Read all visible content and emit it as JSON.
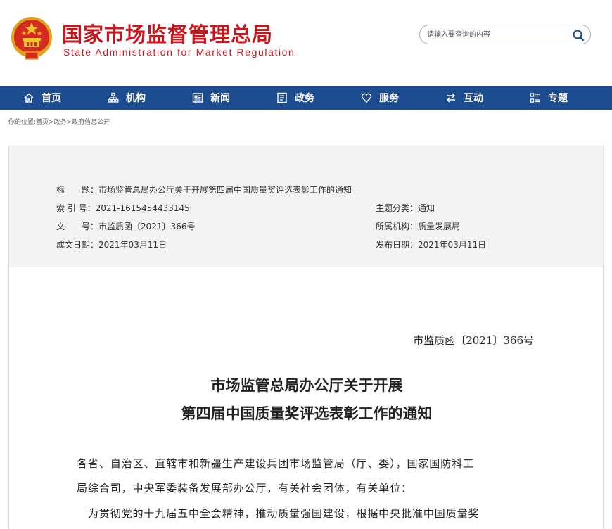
{
  "header": {
    "site_title": "国家市场监督管理总局",
    "site_subtitle": "State Administration for Market Regulation",
    "search_placeholder": "请输入要查询的内容"
  },
  "colors": {
    "brand_red": "#c8161d",
    "nav_blue": "#1c4c8f"
  },
  "nav": [
    {
      "label": "首页",
      "icon": "home-icon"
    },
    {
      "label": "机构",
      "icon": "org-chart-icon"
    },
    {
      "label": "新闻",
      "icon": "news-icon"
    },
    {
      "label": "政务",
      "icon": "government-affairs-icon"
    },
    {
      "label": "服务",
      "icon": "heart-icon"
    },
    {
      "label": "互动",
      "icon": "exchange-arrows-icon"
    },
    {
      "label": "专题",
      "icon": "topics-icon"
    }
  ],
  "breadcrumb": {
    "prefix": "你的位置:",
    "items": [
      "首页",
      "政务",
      "政府信息公开"
    ],
    "separator": ">"
  },
  "info": {
    "title_key": "标　　题：",
    "title_val": "市场监管总局办公厅关于开展第四届中国质量奖评选表彰工作的通知",
    "index_key": "索 引 号：",
    "index_val": "2021-1615454433145",
    "category_key": "主题分类：",
    "category_val": "通知",
    "docno_key": "文　　号：",
    "docno_val": "市监质函〔2021〕366号",
    "org_key": "所属机构：",
    "org_val": "质量发展局",
    "created_key": "成文日期：",
    "created_val": "2021年03月11日",
    "published_key": "发布日期：",
    "published_val": "2021年03月11日"
  },
  "document": {
    "doc_number": "市监质函〔2021〕366号",
    "title_line1": "市场监管总局办公厅关于开展",
    "title_line2": "第四届中国质量奖评选表彰工作的通知",
    "para1_line1": "各省、自治区、直辖市和新疆生产建设兵团市场监管局（厅、委），国家国防科工",
    "para1_line2": "局综合司，中央军委装备发展部办公厅，有关社会团体，有关单位：",
    "para2_line1": "　为贯彻党的十九届五中全会精神，推动质量强国建设，根据中央批准中国质量奖"
  }
}
